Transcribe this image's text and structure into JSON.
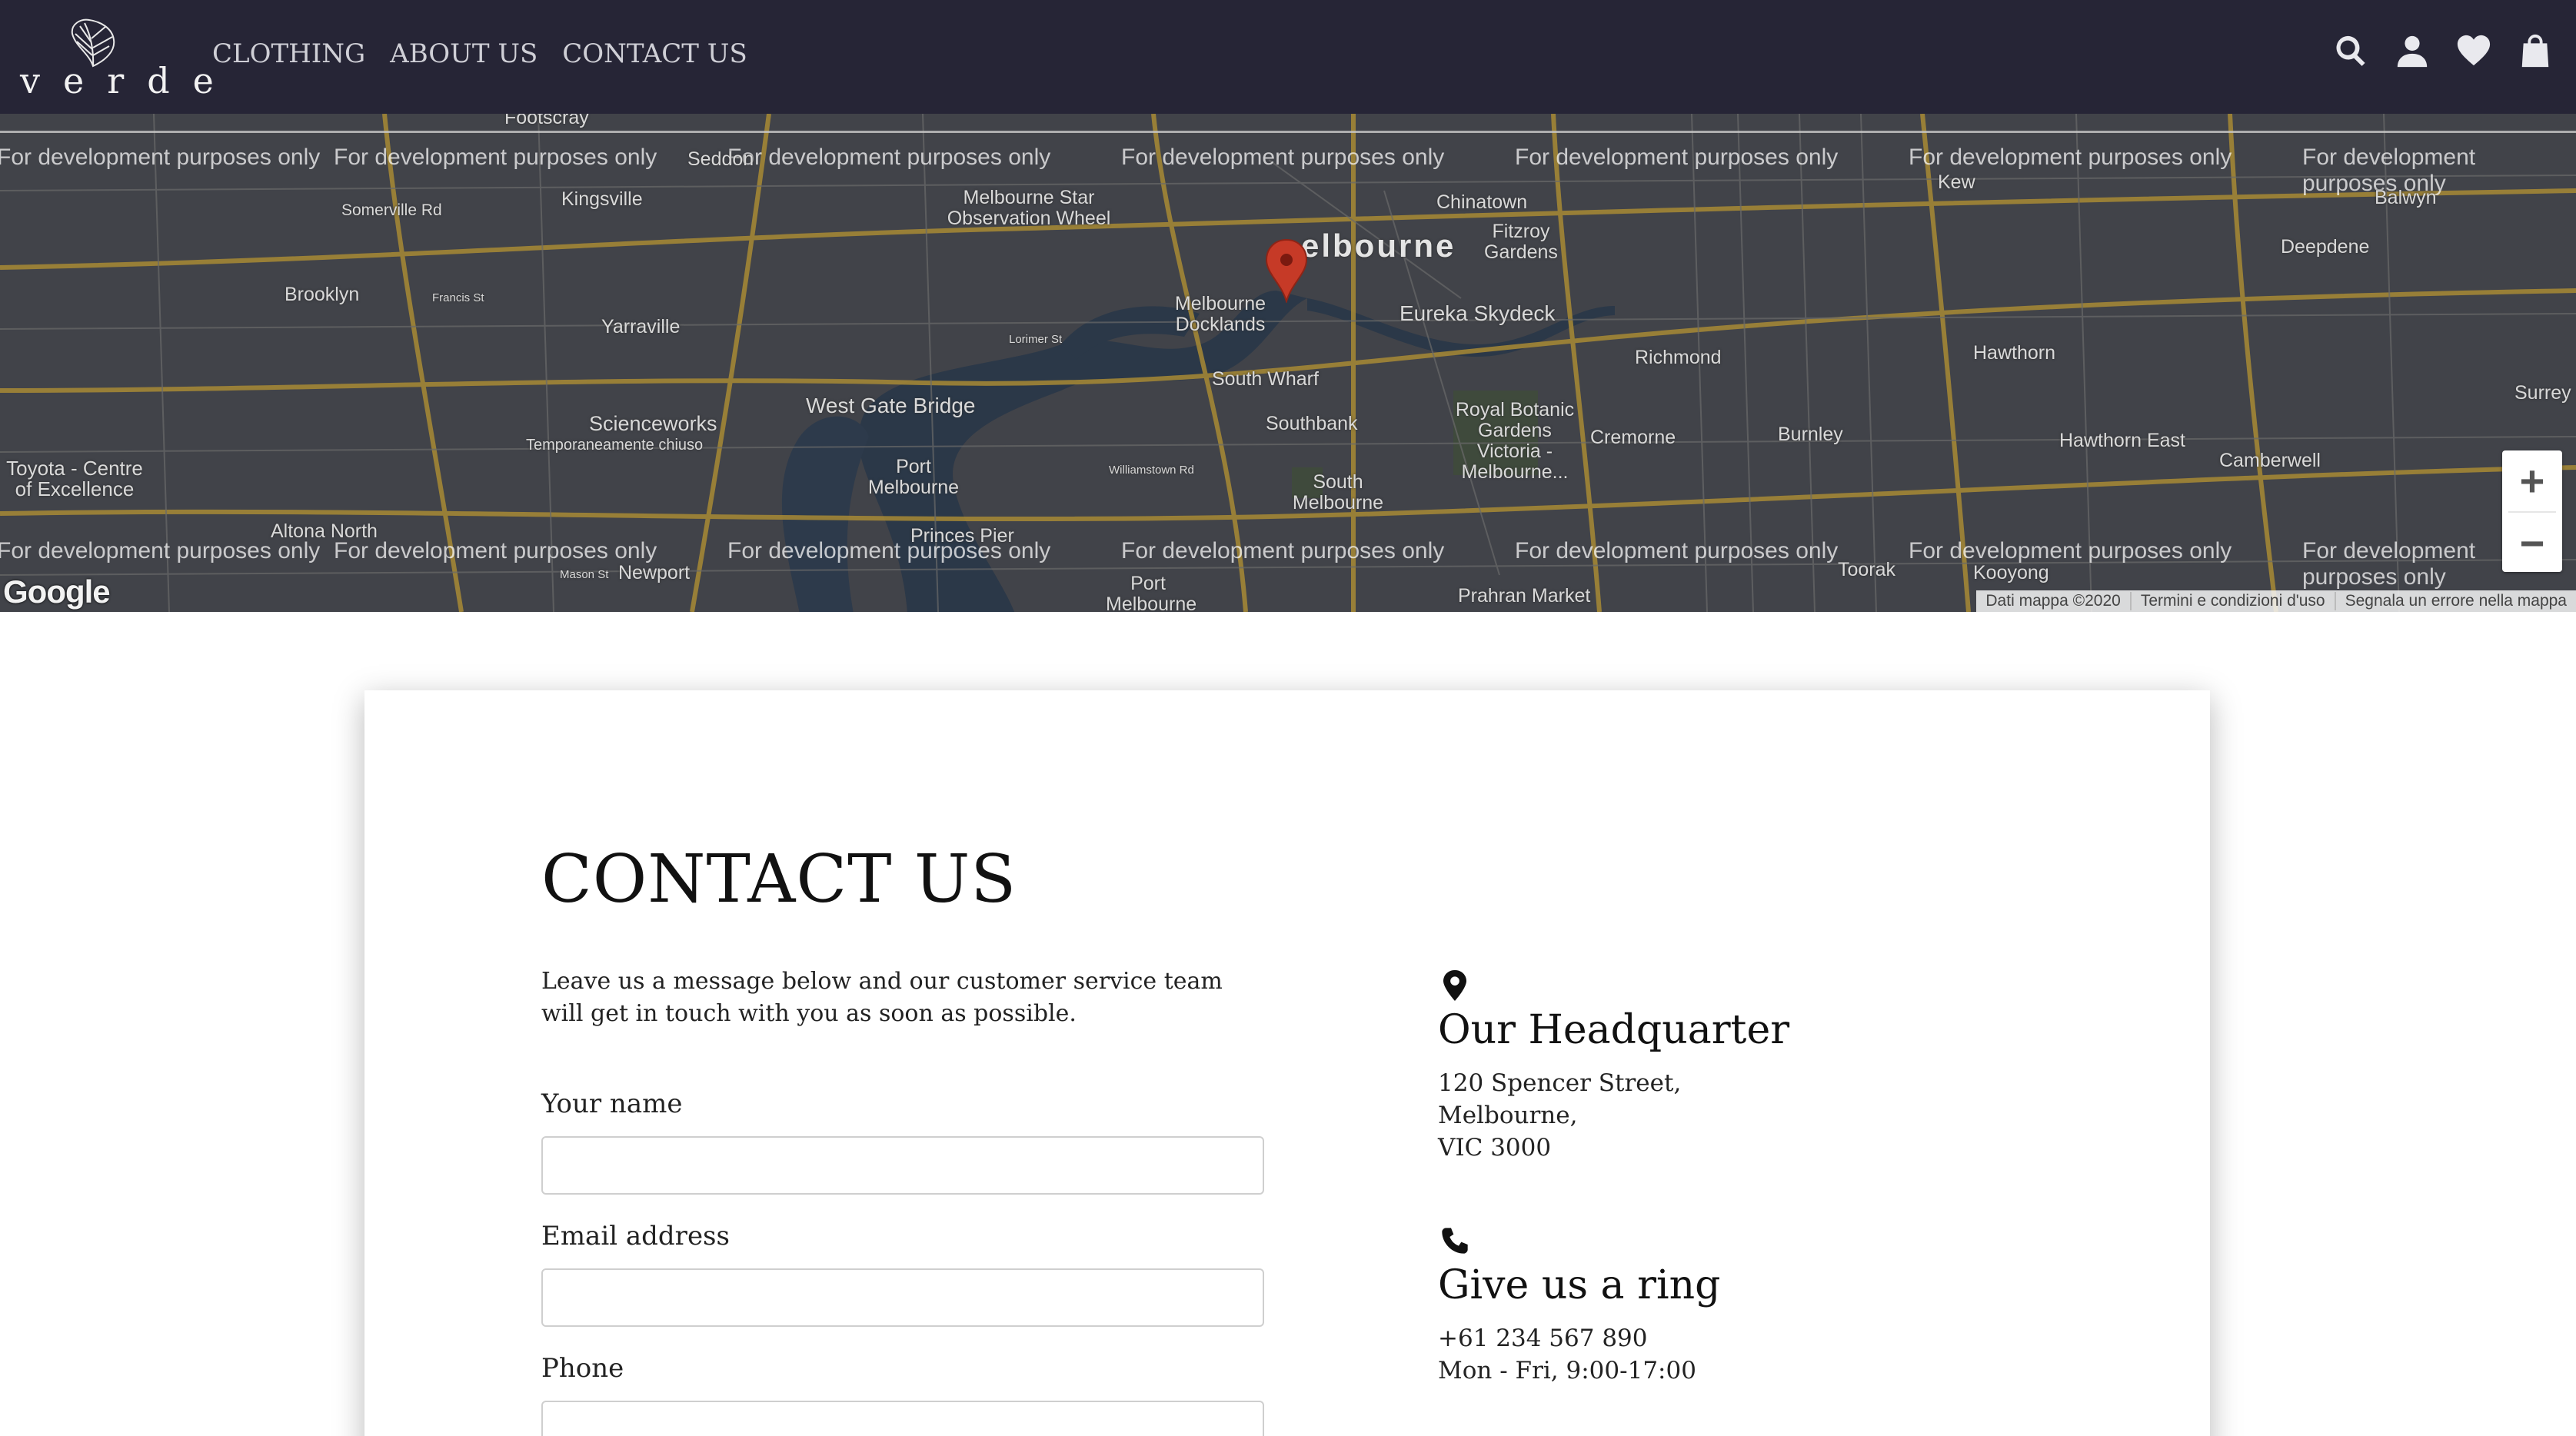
{
  "nav": {
    "logo_text": "verde",
    "links": [
      "CLOTHING",
      "ABOUT US",
      "CONTACT US"
    ],
    "icons": [
      "search-icon",
      "user-icon",
      "heart-icon",
      "bag-icon"
    ]
  },
  "map": {
    "watermark": "For development purposes only",
    "city_label": "elbourne",
    "places": [
      "Footscray",
      "Seddon",
      "Kingsville",
      "Somerville Rd",
      "Brooklyn",
      "Yarraville",
      "Melbourne Star Observation Wheel",
      "Chinatown",
      "Fitzroy Gardens",
      "Eureka Skydeck",
      "Melbourne Docklands",
      "South Wharf",
      "Southbank",
      "Richmond",
      "Kew",
      "Balwyn",
      "Deepdene",
      "Hawthorn",
      "Surrey",
      "West Gate Bridge",
      "Scienceworks",
      "Temporaneamente chiuso",
      "Toyota - Centre of Excellence",
      "Port Melbourne",
      "Royal Botanic Gardens Victoria - Melbourne...",
      "Cremorne",
      "Burnley",
      "Hawthorn East",
      "Camberwell",
      "South Melbourne",
      "Altona North",
      "Newport",
      "Princes Pier",
      "Port Melbourne",
      "Toorak",
      "Kooyong",
      "Prahran Market",
      "Francis St",
      "Lorimer St",
      "Williamstown Rd",
      "Mason St"
    ],
    "zoom_in_label": "+",
    "zoom_out_label": "−",
    "google_label": "Google",
    "attribution": [
      "Dati mappa ©2020",
      "Termini e condizioni d'uso",
      "Segnala un errore nella mappa"
    ]
  },
  "content": {
    "title": "CONTACT US",
    "intro": "Leave us a message below and our customer service team will get in touch with you as soon as possible.",
    "form": {
      "name_label": "Your name",
      "email_label": "Email address",
      "phone_label": "Phone"
    },
    "headquarter": {
      "title": "Our Headquarter",
      "lines": [
        "120 Spencer Street,",
        "Melbourne,",
        "VIC 3000"
      ]
    },
    "ring": {
      "title": "Give us a ring",
      "lines": [
        "+61 234 567 890",
        "Mon - Fri, 9:00-17:00"
      ]
    }
  },
  "colors": {
    "navbar": "#262536",
    "map_bg": "#3e4046",
    "road": "#b0923a",
    "water": "#2c3a4a",
    "pin": "#c63a27"
  }
}
